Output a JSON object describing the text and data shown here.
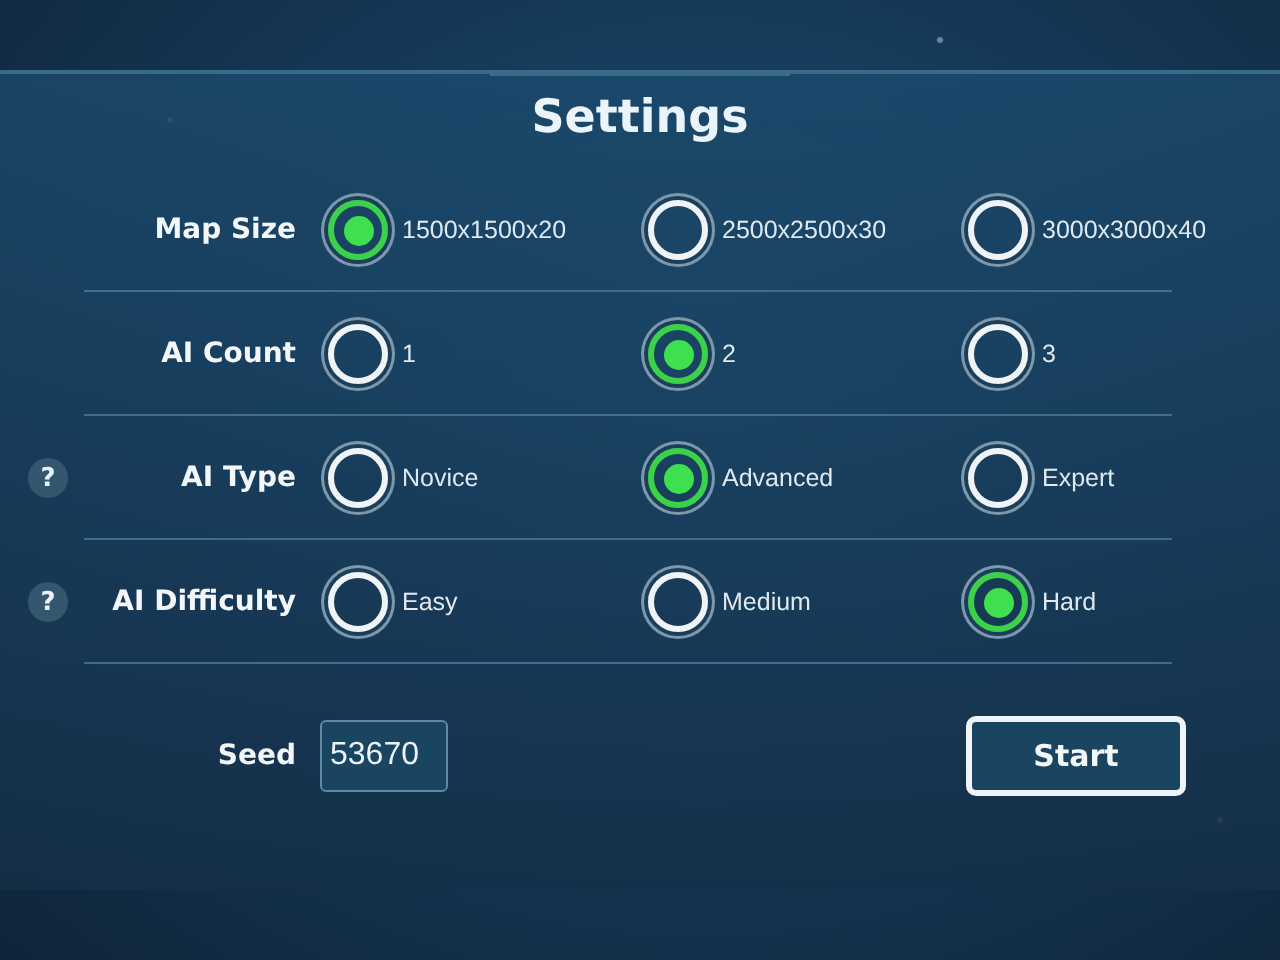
{
  "title": "Settings",
  "rows": [
    {
      "label": "Map Size",
      "options": [
        {
          "label": "1500x1500x20",
          "selected": true
        },
        {
          "label": "2500x2500x30",
          "selected": false
        },
        {
          "label": "3000x3000x40",
          "selected": false
        }
      ]
    },
    {
      "label": "AI Count",
      "options": [
        {
          "label": "1",
          "selected": false
        },
        {
          "label": "2",
          "selected": true
        },
        {
          "label": "3",
          "selected": false
        }
      ]
    },
    {
      "label": "AI Type",
      "help": "?",
      "options": [
        {
          "label": "Novice",
          "selected": false
        },
        {
          "label": "Advanced",
          "selected": true
        },
        {
          "label": "Expert",
          "selected": false
        }
      ]
    },
    {
      "label": "AI Difficulty",
      "help": "?",
      "options": [
        {
          "label": "Easy",
          "selected": false
        },
        {
          "label": "Medium",
          "selected": false
        },
        {
          "label": "Hard",
          "selected": true
        }
      ]
    }
  ],
  "seed": {
    "label": "Seed",
    "value": "53670"
  },
  "start_button": "Start"
}
